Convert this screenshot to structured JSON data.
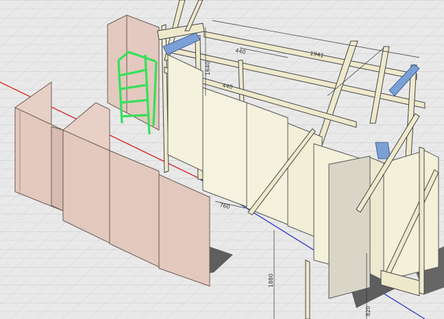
{
  "viewport": {
    "background": "#e9e9e9",
    "grid_color": "#c8c8c8",
    "axis_x_color": "#d42020",
    "axis_y_color": "#2a32c8",
    "panel_color": "#e6cdc3",
    "panel_edge": "#6b5a52",
    "board_color": "#f4f2dc",
    "frame_color": "#efe9cc",
    "connector_color": "#7aa0d6",
    "ladder_color": "#35e05a",
    "shadow_color": "#5f5f5f"
  },
  "dimensions": {
    "top_span": "1941",
    "top_short": "440",
    "post_height": "1640",
    "inner_width": "440",
    "floor_width": "760",
    "column_height": "1880",
    "bottom_right": "820"
  }
}
